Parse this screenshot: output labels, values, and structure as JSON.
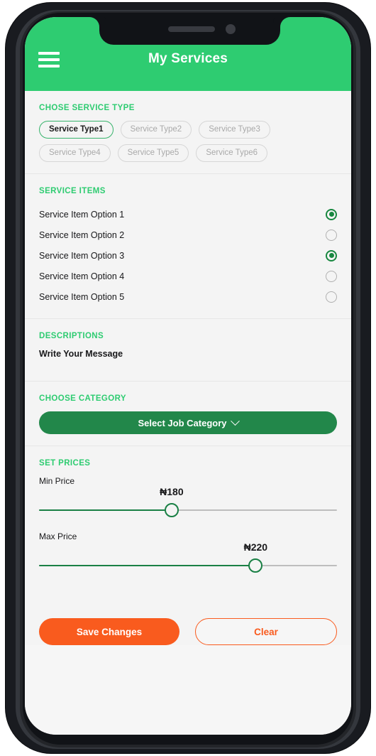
{
  "app": {
    "title": "My Services",
    "menu_icon": "hamburger-menu-icon",
    "header_color": "#2ecc71"
  },
  "service_type": {
    "section_title": "CHOSE SERVICE TYPE",
    "chips": [
      {
        "label": "Service Type1",
        "selected": true
      },
      {
        "label": "Service Type2",
        "selected": false
      },
      {
        "label": "Service Type3",
        "selected": false
      },
      {
        "label": "Service Type4",
        "selected": false
      },
      {
        "label": "Service Type5",
        "selected": false
      },
      {
        "label": "Service Type6",
        "selected": false
      }
    ]
  },
  "service_items": {
    "section_title": "SERVICE ITEMS",
    "options": [
      {
        "label": "Service Item Option 1",
        "selected": true
      },
      {
        "label": "Service Item Option 2",
        "selected": false
      },
      {
        "label": "Service Item Option 3",
        "selected": true
      },
      {
        "label": "Service Item Option 4",
        "selected": false
      },
      {
        "label": "Service Item Option 5",
        "selected": false
      }
    ]
  },
  "descriptions": {
    "section_title": "DESCRIPTIONS",
    "message_placeholder": "Write Your Message",
    "message_value": "Write Your Message"
  },
  "category": {
    "section_title": "CHOOSE CATEGORY",
    "button_label": "Select Job Category",
    "chevron_icon": "chevron-down-icon",
    "button_color": "#22874a"
  },
  "prices": {
    "section_title": "SET PRICES",
    "min": {
      "label": "Min Price",
      "value_text": "₦180",
      "percent": 44.5
    },
    "max": {
      "label": "Max Price",
      "value_text": "₦220",
      "percent": 72.7
    },
    "track_color": "#bdbdbd",
    "fill_color": "#1a8045"
  },
  "actions": {
    "save_label": "Save Changes",
    "clear_label": "Clear",
    "accent_color": "#f95b1e"
  }
}
